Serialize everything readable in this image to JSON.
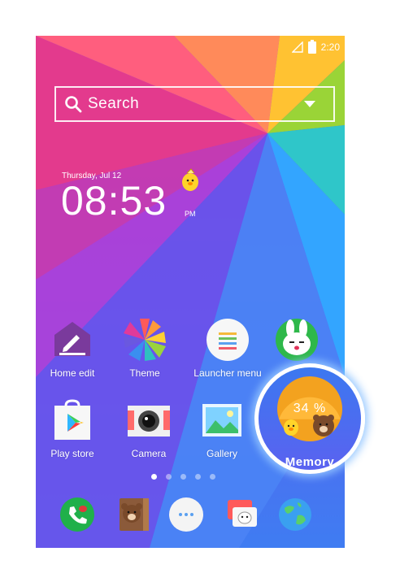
{
  "status_bar": {
    "time": "2:20"
  },
  "search": {
    "placeholder": "Search"
  },
  "clock": {
    "date": "Thursday, Jul 12",
    "time": "08:53",
    "ampm": "PM"
  },
  "apps_row1": [
    {
      "label": "Home edit",
      "icon": "home-edit-icon"
    },
    {
      "label": "Theme",
      "icon": "pinwheel-icon"
    },
    {
      "label": "Launcher menu",
      "icon": "menu-lines-icon"
    },
    {
      "label": "",
      "icon": "cony-bunny-icon"
    }
  ],
  "apps_row2": [
    {
      "label": "Play store",
      "icon": "play-store-icon"
    },
    {
      "label": "Camera",
      "icon": "camera-icon"
    },
    {
      "label": "Gallery",
      "icon": "gallery-icon"
    }
  ],
  "memory": {
    "percent": "34 %",
    "label": "Memory",
    "usage": 0.34,
    "color": "#f3a21f"
  },
  "dock": [
    "phone-icon",
    "brown-bear-book-icon",
    "app-drawer-icon",
    "messages-icon",
    "browser-globe-icon"
  ],
  "page_indicator": {
    "pages": 5,
    "active": 0
  },
  "colors": {
    "wallpaper_base": "#7a3bdc",
    "memory_ring": "#3c78f0"
  }
}
